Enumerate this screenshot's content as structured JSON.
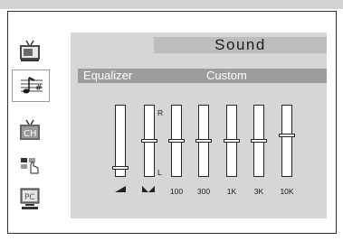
{
  "menu": {
    "title": "Sound",
    "items": [
      {
        "name": "picture",
        "icon": "tv-picture-icon",
        "active": false
      },
      {
        "name": "sound",
        "icon": "music-note-icon",
        "active": true
      },
      {
        "name": "channel",
        "icon": "channel-icon",
        "active": false,
        "text": "CH"
      },
      {
        "name": "setup",
        "icon": "hand-setup-icon",
        "active": false
      },
      {
        "name": "pc",
        "icon": "pc-icon",
        "active": false,
        "text": "PC"
      }
    ]
  },
  "equalizer": {
    "label": "Equalizer",
    "value": "Custom",
    "balance_labels": {
      "right": "R",
      "left": "L"
    },
    "sliders": [
      {
        "id": "volume",
        "label_icon": "volume-ramp-icon",
        "level": 0.1
      },
      {
        "id": "balance",
        "label_icon": "balance-icon",
        "level": 0.5
      },
      {
        "id": "100",
        "label": "100",
        "level": 0.5
      },
      {
        "id": "300",
        "label": "300",
        "level": 0.5
      },
      {
        "id": "1K",
        "label": "1K",
        "level": 0.5
      },
      {
        "id": "3K",
        "label": "3K",
        "level": 0.5
      },
      {
        "id": "10K",
        "label": "10K",
        "level": 0.58
      }
    ]
  },
  "colors": {
    "panel_bg": "#d6d6d6",
    "title_bg": "#bdbdbd",
    "eq_bar_bg": "#9d9d9d",
    "frame_border": "#2e2e2e"
  }
}
